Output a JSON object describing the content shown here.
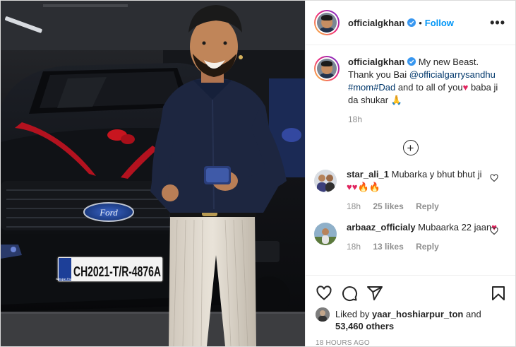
{
  "post": {
    "username": "officialgkhan",
    "follow_label": "Follow",
    "more_label": "•••",
    "caption": {
      "username": "officialgkhan",
      "text_1": " My new Beast. Thank you Bai ",
      "mention": "@officialgarrysandhu",
      "hashtags": "#mom#Dad",
      "text_2": " and to all of you",
      "heart": "♥",
      "text_3": " baba ji da shukar ",
      "pray": "🙏",
      "age": "18h"
    },
    "load_more": "+",
    "comments": [
      {
        "username": "star_ali_1",
        "text": " Mubarka y bhut bhut ji",
        "emojis": "♥♥🔥🔥",
        "age": "18h",
        "likes": "25 likes",
        "reply_label": "Reply"
      },
      {
        "username": "arbaaz_officialy",
        "text": " Mubaarka 22 jaan",
        "emojis": "♥",
        "age": "18h",
        "likes": "13 likes",
        "reply_label": "Reply"
      }
    ],
    "liked_by": {
      "prefix": "Liked by ",
      "username": "yaar_hoshiarpur_ton",
      "middle": " and ",
      "count": "53,460 others"
    },
    "timestamp": "18 HOURS AGO",
    "photo": {
      "plate_text": "CH2021-T/R-4876A",
      "plate_badge": "Bahujan Pavel",
      "badge_text": "Ford"
    }
  },
  "colors": {
    "accent": "#0095f6",
    "heart": "#e0245e",
    "muted": "#8e8e8e",
    "text": "#262626",
    "verified": "#3897f0"
  },
  "icons": {
    "like": "heart-outline-icon",
    "comment": "speech-bubble-icon",
    "share": "paper-plane-icon",
    "save": "bookmark-icon",
    "more": "ellipsis-icon",
    "verified": "verified-badge-icon",
    "load_more": "plus-circle-icon",
    "comment_like": "small-heart-icon"
  }
}
